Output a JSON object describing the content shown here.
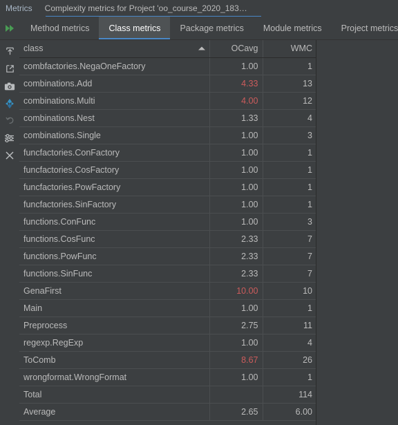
{
  "window": {
    "panel_label": "Metrics",
    "document_title": "Complexity metrics for Project 'oo_course_2020_183…"
  },
  "tabs": [
    {
      "label": "Method metrics",
      "active": false
    },
    {
      "label": "Class metrics",
      "active": true
    },
    {
      "label": "Package metrics",
      "active": false
    },
    {
      "label": "Module metrics",
      "active": false
    },
    {
      "label": "Project metrics",
      "active": false
    }
  ],
  "toolbar_left": [
    {
      "icon": "export-up-icon",
      "enabled": true
    },
    {
      "icon": "open-external-icon",
      "enabled": true
    },
    {
      "icon": "camera-snapshot-icon",
      "enabled": true
    },
    {
      "icon": "diff-compare-icon",
      "enabled": true
    },
    {
      "icon": "undo-revert-icon",
      "enabled": false
    },
    {
      "icon": "settings-sliders-icon",
      "enabled": true
    },
    {
      "icon": "close-icon",
      "enabled": true
    }
  ],
  "toolbar_top": {
    "run_icon": "fast-forward-icon"
  },
  "table": {
    "columns": [
      {
        "key": "class",
        "label": "class",
        "align": "left",
        "sorted": "asc"
      },
      {
        "key": "ocavg",
        "label": "OCavg",
        "align": "right",
        "sorted": "none"
      },
      {
        "key": "wmc",
        "label": "WMC",
        "align": "right",
        "sorted": "none"
      }
    ],
    "highlight_color": "#cc5c5c",
    "rows": [
      {
        "class": "combfactories.NegaOneFactory",
        "ocavg": "1.00",
        "wmc": "1",
        "ocavg_hot": false
      },
      {
        "class": "combinations.Add",
        "ocavg": "4.33",
        "wmc": "13",
        "ocavg_hot": true
      },
      {
        "class": "combinations.Multi",
        "ocavg": "4.00",
        "wmc": "12",
        "ocavg_hot": true
      },
      {
        "class": "combinations.Nest",
        "ocavg": "1.33",
        "wmc": "4",
        "ocavg_hot": false
      },
      {
        "class": "combinations.Single",
        "ocavg": "1.00",
        "wmc": "3",
        "ocavg_hot": false
      },
      {
        "class": "funcfactories.ConFactory",
        "ocavg": "1.00",
        "wmc": "1",
        "ocavg_hot": false
      },
      {
        "class": "funcfactories.CosFactory",
        "ocavg": "1.00",
        "wmc": "1",
        "ocavg_hot": false
      },
      {
        "class": "funcfactories.PowFactory",
        "ocavg": "1.00",
        "wmc": "1",
        "ocavg_hot": false
      },
      {
        "class": "funcfactories.SinFactory",
        "ocavg": "1.00",
        "wmc": "1",
        "ocavg_hot": false
      },
      {
        "class": "functions.ConFunc",
        "ocavg": "1.00",
        "wmc": "3",
        "ocavg_hot": false
      },
      {
        "class": "functions.CosFunc",
        "ocavg": "2.33",
        "wmc": "7",
        "ocavg_hot": false
      },
      {
        "class": "functions.PowFunc",
        "ocavg": "2.33",
        "wmc": "7",
        "ocavg_hot": false
      },
      {
        "class": "functions.SinFunc",
        "ocavg": "2.33",
        "wmc": "7",
        "ocavg_hot": false
      },
      {
        "class": "GenaFirst",
        "ocavg": "10.00",
        "wmc": "10",
        "ocavg_hot": true
      },
      {
        "class": "Main",
        "ocavg": "1.00",
        "wmc": "1",
        "ocavg_hot": false
      },
      {
        "class": "Preprocess",
        "ocavg": "2.75",
        "wmc": "11",
        "ocavg_hot": false
      },
      {
        "class": "regexp.RegExp",
        "ocavg": "1.00",
        "wmc": "4",
        "ocavg_hot": false
      },
      {
        "class": "ToComb",
        "ocavg": "8.67",
        "wmc": "26",
        "ocavg_hot": true
      },
      {
        "class": "wrongformat.WrongFormat",
        "ocavg": "1.00",
        "wmc": "1",
        "ocavg_hot": false
      },
      {
        "class": "Total",
        "ocavg": "",
        "wmc": "114",
        "ocavg_hot": false
      },
      {
        "class": "Average",
        "ocavg": "2.65",
        "wmc": "6.00",
        "ocavg_hot": false
      }
    ]
  }
}
